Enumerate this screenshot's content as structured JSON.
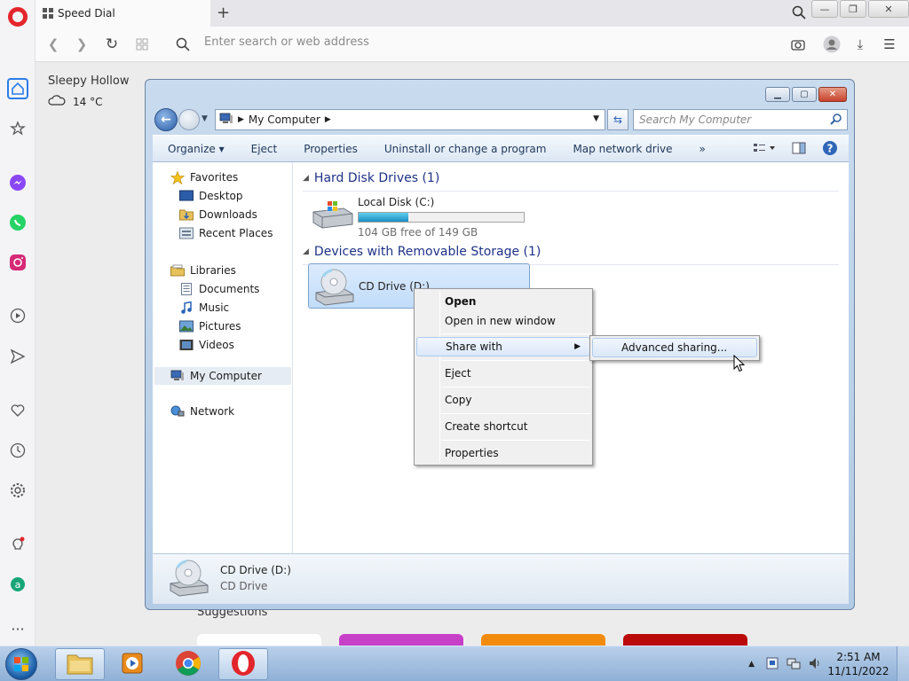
{
  "browser": {
    "tab_title": "Speed Dial",
    "address_placeholder": "Enter search or web address",
    "weather_city": "Sleepy Hollow",
    "weather_temp": "14 °C",
    "suggestions_label": "Suggestions"
  },
  "explorer": {
    "path": "My Computer",
    "search_placeholder": "Search My Computer",
    "toolbar": [
      "Organize",
      "Eject",
      "Properties",
      "Uninstall or change a program",
      "Map network drive",
      "»"
    ],
    "nav": {
      "favorites": "Favorites",
      "desktop": "Desktop",
      "downloads": "Downloads",
      "recent_places": "Recent Places",
      "libraries": "Libraries",
      "documents": "Documents",
      "music": "Music",
      "pictures": "Pictures",
      "videos": "Videos",
      "my_computer": "My Computer",
      "network": "Network"
    },
    "groups": {
      "hdd": "Hard Disk Drives (1)",
      "removable": "Devices with Removable Storage (1)"
    },
    "disk_c": {
      "name": "Local Disk (C:)",
      "free_text": "104 GB free of 149 GB",
      "used_fraction": 0.302
    },
    "cd_drive": {
      "name": "CD Drive (D:)",
      "type": "CD Drive"
    }
  },
  "context_menu": {
    "items": [
      "Open",
      "Open in new window",
      "Share with",
      "Eject",
      "Copy",
      "Create shortcut",
      "Properties"
    ],
    "submenu_item": "Advanced sharing..."
  },
  "taskbar": {
    "time": "2:51 AM",
    "date": "11/11/2022"
  },
  "colors": {
    "opera_red": "#e3262c",
    "explorer_frame": "#b3cbe5",
    "taskbar": "#8fb0d6"
  }
}
